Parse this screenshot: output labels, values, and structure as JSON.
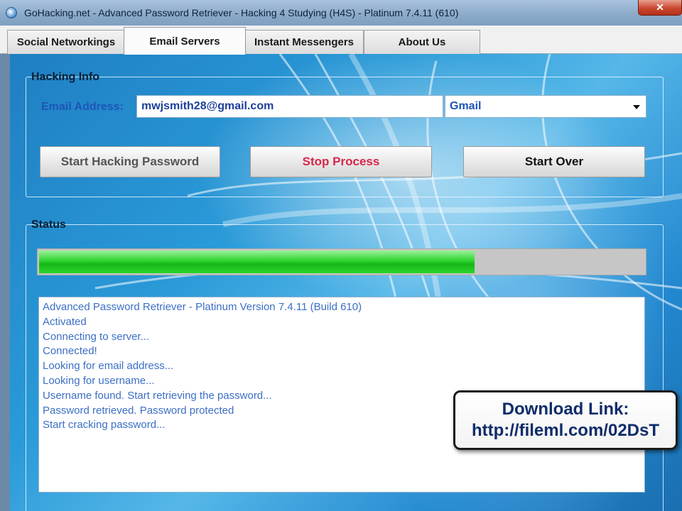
{
  "window": {
    "title": "GoHacking.net - Advanced Password Retriever - Hacking 4 Studying (H4S) - Platinum 7.4.11 (610)",
    "close_glyph": "✕"
  },
  "tabs": [
    {
      "label": "Social Networkings",
      "active": false
    },
    {
      "label": "Email Servers",
      "active": true
    },
    {
      "label": "Instant Messengers",
      "active": false
    },
    {
      "label": "About Us",
      "active": false
    }
  ],
  "hacking_info": {
    "group_label": "Hacking Info",
    "email_label": "Email Address:",
    "email_value": "mwjsmith28@gmail.com",
    "provider_selected": "Gmail",
    "buttons": {
      "start": "Start Hacking Password",
      "stop": "Stop Process",
      "start_over": "Start Over"
    }
  },
  "status": {
    "group_label": "Status",
    "progress_fraction": 0.72,
    "log_lines": [
      "Advanced Password Retriever - Platinum Version 7.4.11 (Build 610)",
      "Activated",
      "Connecting to server...",
      "Connected!",
      "Looking for email address...",
      "Looking for username...",
      "Username found. Start retrieving the password...",
      "Password retrieved. Password protected",
      "Start cracking password..."
    ]
  },
  "overlay": {
    "line1": "Download Link:",
    "line2": "http://fileml.com/02DsT"
  },
  "colors": {
    "accent_blue": "#1e55b8",
    "stop_red": "#d8264a",
    "progress_green": "#22c722",
    "log_text": "#3c6fc4"
  },
  "icons": {
    "app": "app-globe-icon",
    "close": "close-icon",
    "dropdown": "chevron-down-icon"
  }
}
